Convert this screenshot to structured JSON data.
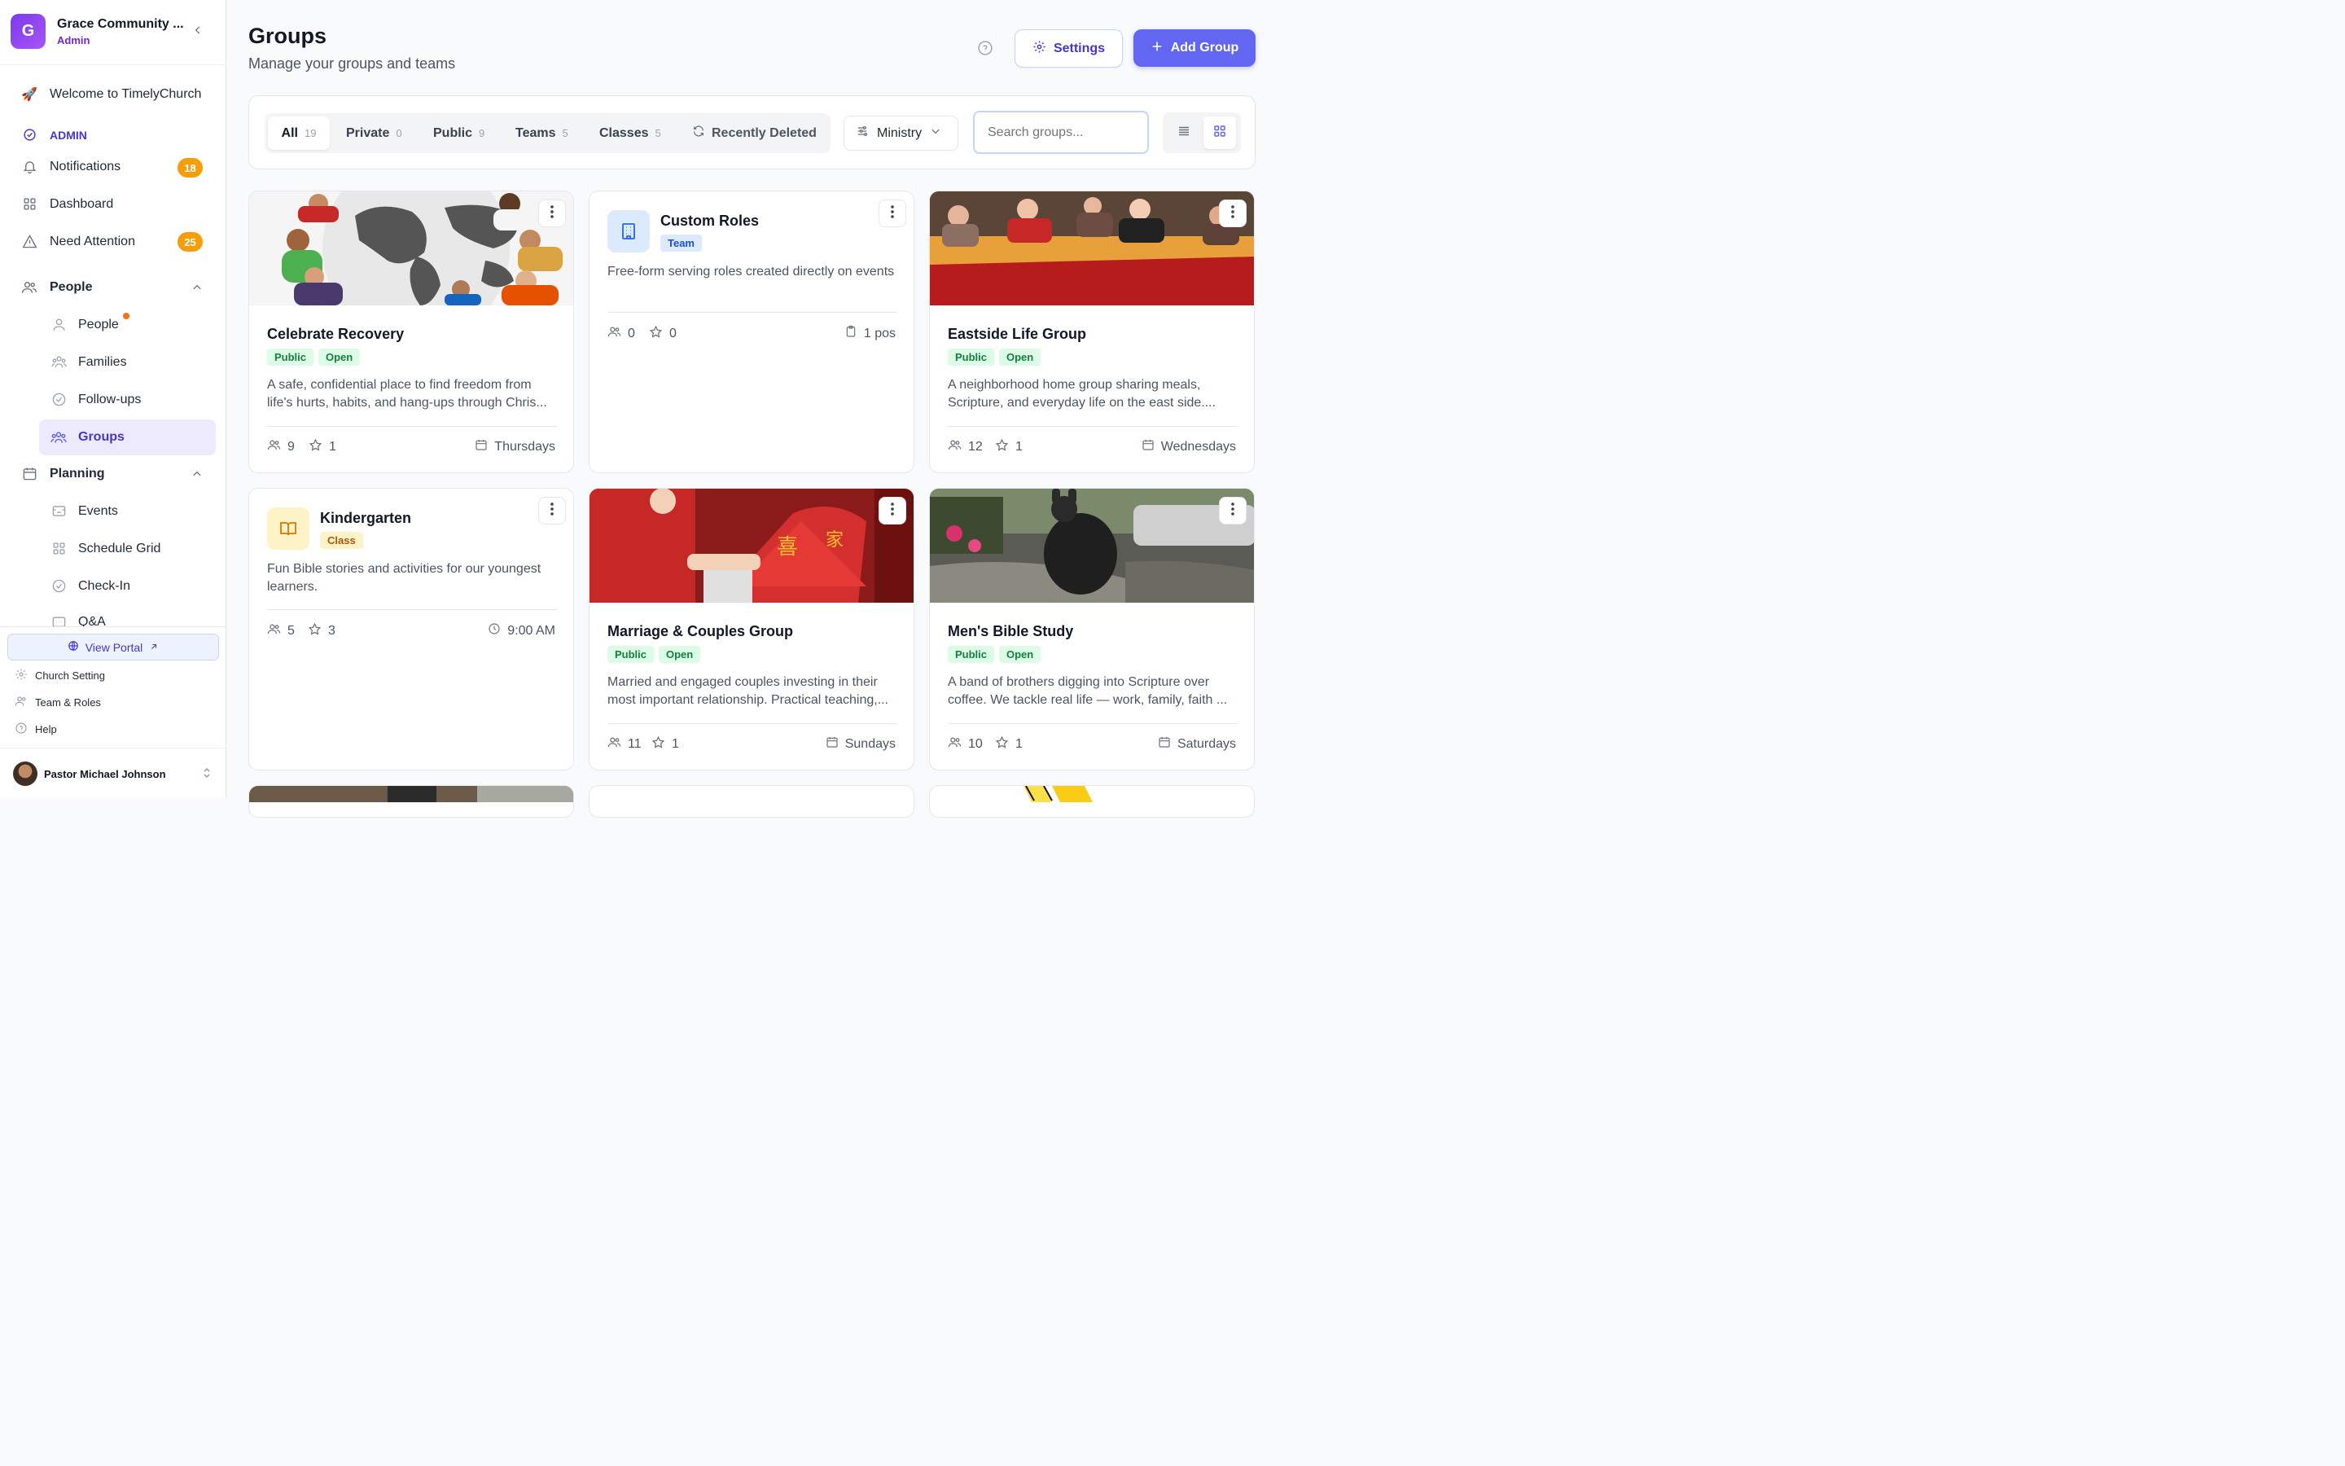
{
  "sidebar": {
    "org_initial": "G",
    "org_name": "Grace Community ...",
    "org_role": "Admin",
    "welcome": "Welcome to TimelyChurch",
    "admin_label": "ADMIN",
    "notifications": {
      "label": "Notifications",
      "count": "18"
    },
    "dashboard": "Dashboard",
    "need_attention": {
      "label": "Need Attention",
      "count": "25"
    },
    "people_section": "People",
    "people_items": [
      "People",
      "Families",
      "Follow-ups",
      "Groups"
    ],
    "planning_section": "Planning",
    "planning_items": [
      "Events",
      "Schedule Grid",
      "Check-In",
      "Q&A"
    ],
    "view_portal": "View Portal",
    "footer_links": [
      "Church Setting",
      "Team & Roles",
      "Help"
    ],
    "user_name": "Pastor Michael Johnson"
  },
  "header": {
    "title": "Groups",
    "subtitle": "Manage your groups and teams",
    "settings_label": "Settings",
    "add_label": "Add Group"
  },
  "filters": {
    "tabs": [
      {
        "label": "All",
        "count": "19"
      },
      {
        "label": "Private",
        "count": "0"
      },
      {
        "label": "Public",
        "count": "9"
      },
      {
        "label": "Teams",
        "count": "5"
      },
      {
        "label": "Classes",
        "count": "5"
      },
      {
        "label": "Recently Deleted",
        "count": ""
      }
    ],
    "ministry": "Ministry",
    "search_placeholder": "Search groups..."
  },
  "groups": [
    {
      "title": "Celebrate Recovery",
      "tags": [
        "Public",
        "Open"
      ],
      "desc": "A safe, confidential place to find freedom from life's hurts, habits, and hang-ups through Chris...",
      "members": "9",
      "leaders": "1",
      "meta": "Thursdays"
    },
    {
      "title": "Custom Roles",
      "tags": [
        "Team"
      ],
      "desc": "Free-form serving roles created directly on events",
      "members": "0",
      "leaders": "0",
      "meta": "1 pos"
    },
    {
      "title": "Eastside Life Group",
      "tags": [
        "Public",
        "Open"
      ],
      "desc": "A neighborhood home group sharing meals, Scripture, and everyday life on the east side....",
      "members": "12",
      "leaders": "1",
      "meta": "Wednesdays"
    },
    {
      "title": "Kindergarten",
      "tags": [
        "Class"
      ],
      "desc": "Fun Bible stories and activities for our youngest learners.",
      "members": "5",
      "leaders": "3",
      "meta": "9:00 AM"
    },
    {
      "title": "Marriage & Couples Group",
      "tags": [
        "Public",
        "Open"
      ],
      "desc": "Married and engaged couples investing in their most important relationship. Practical teaching,...",
      "members": "11",
      "leaders": "1",
      "meta": "Sundays"
    },
    {
      "title": "Men's Bible Study",
      "tags": [
        "Public",
        "Open"
      ],
      "desc": "A band of brothers digging into Scripture over coffee. We tackle real life — work, family, faith ...",
      "members": "10",
      "leaders": "1",
      "meta": "Saturdays"
    }
  ],
  "colors": {
    "accent": "#6366f1",
    "badge": "#f59e0b",
    "public_tag": "#15803d",
    "team_tag": "#1d4ed8",
    "class_tag": "#b45309"
  }
}
